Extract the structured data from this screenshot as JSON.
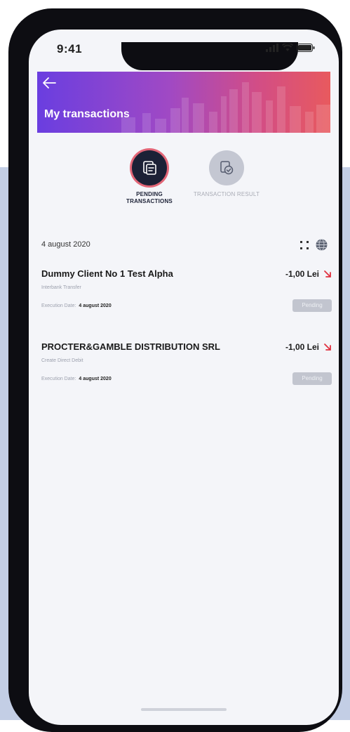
{
  "status_bar": {
    "time": "9:41"
  },
  "header": {
    "title": "My transactions"
  },
  "tabs": [
    {
      "label": "PENDING TRANSACTIONS",
      "active": true
    },
    {
      "label": "TRANSACTION RESULT",
      "active": false
    }
  ],
  "date_group": {
    "date": "4 august 2020"
  },
  "transactions": [
    {
      "name": "Dummy Client No 1 Test Alpha",
      "amount": "-1,00 Lei",
      "type": "Interbank Transfer",
      "execution_label": "Execution Date:",
      "execution_date": "4 august 2020",
      "status": "Pending"
    },
    {
      "name": "PROCTER&GAMBLE DISTRIBUTION SRL",
      "amount": "-1,00 Lei",
      "type": "Create Direct Debit",
      "execution_label": "Execution Date:",
      "execution_date": "4 august 2020",
      "status": "Pending"
    }
  ],
  "colors": {
    "header_gradient_start": "#6a3ee0",
    "header_gradient_end": "#e85a5e",
    "active_ring": "#e26677",
    "debit_arrow": "#e0303f",
    "status_badge": "#c2c5cf"
  }
}
